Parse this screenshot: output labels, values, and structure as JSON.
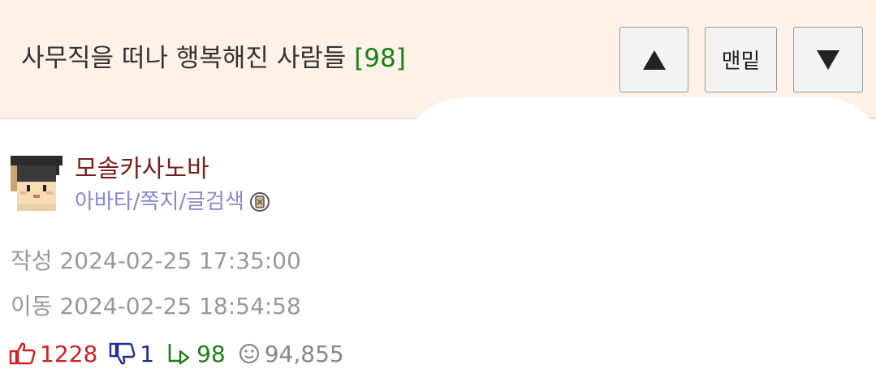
{
  "header": {
    "title": "사무직을 떠나 행복해진 사람들",
    "comment_count": "[98]",
    "bottom_button_label": "맨밑",
    "up_icon": "triangle-up-icon",
    "down_icon": "triangle-down-icon"
  },
  "author": {
    "nickname": "모솔카사노바",
    "avatar_icon": "pixel-avatar-graduation-cap",
    "links": [
      "아바타",
      "쪽지",
      "글검색"
    ],
    "separator": "/",
    "badge_icon": "level-badge-icon"
  },
  "meta": {
    "written": {
      "label": "작성",
      "value": "2024-02-25 17:35:00"
    },
    "moved": {
      "label": "이동",
      "value": "2024-02-25 18:54:58"
    }
  },
  "stats": {
    "upvotes": "1228",
    "downvotes": "1",
    "replies": "98",
    "views": "94,855"
  },
  "colors": {
    "header_bg": "#fdf1e8",
    "author": "#7a1f1f",
    "links": "#8888cc",
    "upvote": "#cc2222",
    "downvote": "#1f2f9e",
    "reply": "#1a7f1a",
    "muted": "#999999"
  }
}
